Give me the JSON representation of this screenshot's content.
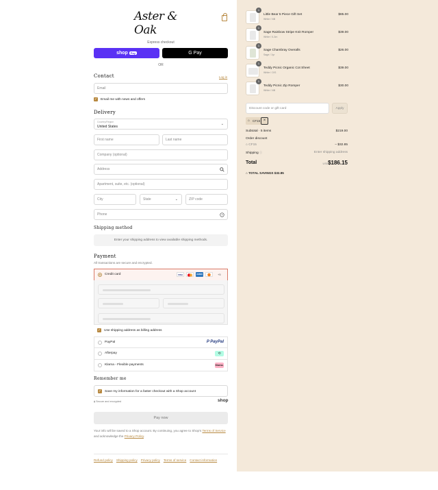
{
  "brand": {
    "logo_text": "Aster & Oak"
  },
  "express": {
    "title": "Express checkout",
    "shop_pay_label": "shop",
    "shop_pay_badge": "Pay",
    "gpay_label": "G Pay",
    "or_label": "OR"
  },
  "contact": {
    "heading": "Contact",
    "login_link": "Log in",
    "email_placeholder": "Email",
    "news_label": "Email me with news and offers"
  },
  "delivery": {
    "heading": "Delivery",
    "country_label": "Country/Region",
    "country_value": "United States",
    "first_name": "First name",
    "last_name": "Last name",
    "company": "Company (optional)",
    "address": "Address",
    "apartment": "Apartment, suite, etc. (optional)",
    "city": "City",
    "state": "State",
    "zip": "ZIP code",
    "phone": "Phone"
  },
  "shipping_method": {
    "heading": "Shipping method",
    "notice": "Enter your shipping address to view available shipping methods."
  },
  "payment": {
    "heading": "Payment",
    "subtitle": "All transactions are secure and encrypted.",
    "credit_card_label": "Credit card",
    "card_logos": [
      "VISA",
      "MC",
      "AMEX",
      "DISC"
    ],
    "more_cards": "+5",
    "billing_same_label": "Use shipping address as billing address",
    "paypal_label": "PayPal",
    "paypal_logo": "P PayPal",
    "afterpay_label": "Afterpay",
    "klarna_label": "Klarna - Flexible payments",
    "klarna_logo": "Klarna."
  },
  "remember": {
    "heading": "Remember me",
    "save_label": "Save my information for a faster checkout with a Shop account",
    "secure_label": "Secure and encrypted",
    "shop_logo": "shop"
  },
  "pay_now_label": "Pay now",
  "legal": {
    "text_before": "Your info will be saved to a Shop account. By continuing, you agree to Shop's ",
    "terms_link": "Terms of Service",
    "text_middle": " and acknowledge the ",
    "privacy_link": "Privacy Policy",
    "text_after": "."
  },
  "footer_links": [
    "Refund policy",
    "Shipping policy",
    "Privacy policy",
    "Terms of service",
    "Contact information"
  ],
  "cart": {
    "items": [
      {
        "qty": "1",
        "name": "Little Bear 5 Piece Gift Set",
        "variant": "White / NB",
        "price": "$85.00"
      },
      {
        "qty": "1",
        "name": "Sage Rainbow Stripe Knit Romper",
        "variant": "White / 0-3m",
        "price": "$39.00"
      },
      {
        "qty": "1",
        "name": "Sage Chambray Overalls",
        "variant": "Sage / 1yr",
        "price": "$26.00"
      },
      {
        "qty": "1",
        "name": "Teddy Picnic Organic Cot Sheet",
        "variant": "White / O/S",
        "price": "$39.00"
      },
      {
        "qty": "1",
        "name": "Teddy Picnic Zip Romper",
        "variant": "White / NB",
        "price": "$30.00"
      }
    ],
    "discount_placeholder": "Discount code or gift card",
    "apply_label": "Apply",
    "applied_code": "CF15",
    "subtotal_label": "Subtotal · 5 items",
    "subtotal_value": "$219.00",
    "order_discount_label": "Order discount",
    "discount_code": "CF15",
    "discount_value": "– $32.85",
    "shipping_label": "Shipping",
    "shipping_value": "Enter shipping address",
    "total_label": "Total",
    "currency": "USD",
    "total_value": "$186.15",
    "savings_label": "TOTAL SAVINGS",
    "savings_value": "$32.85"
  },
  "colors": {
    "accent": "#b7883f",
    "shop_pay": "#5a31f4",
    "sidebar_bg": "#f4e9da"
  }
}
